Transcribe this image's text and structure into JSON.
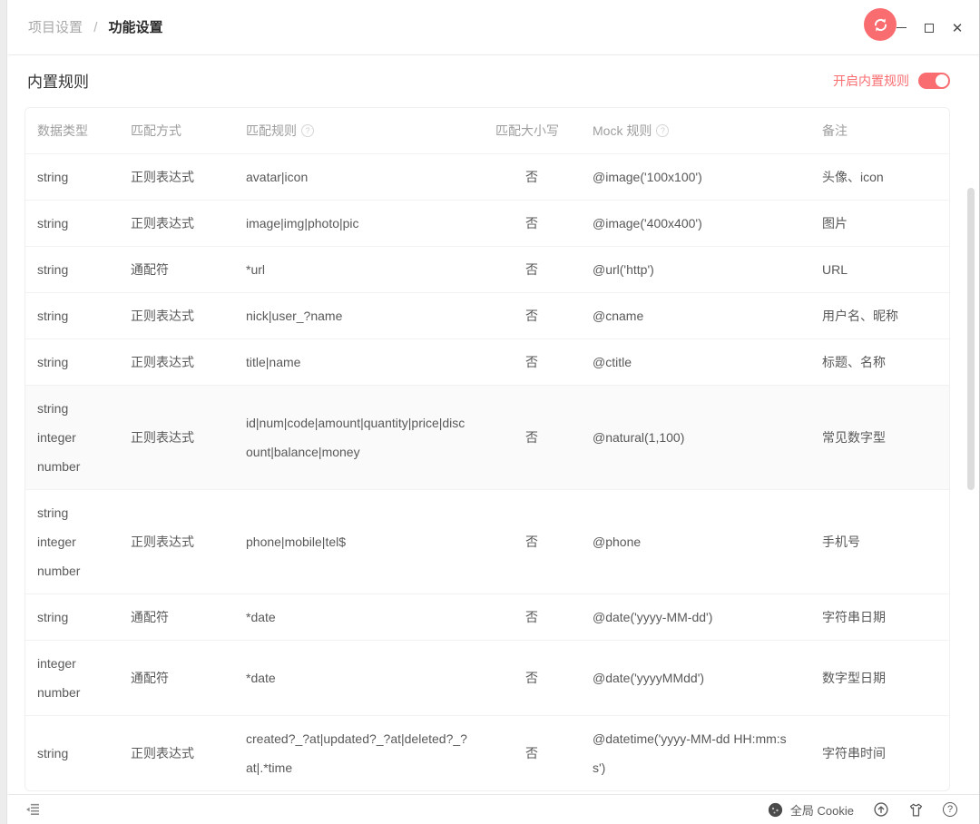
{
  "window": {
    "breadcrumb": {
      "parent": "项目设置",
      "separator": "/",
      "current": "功能设置"
    },
    "controls": {
      "close_glyph": "✕"
    }
  },
  "section": {
    "title": "内置规则",
    "toggle_label": "开启内置规则",
    "toggle_on": true
  },
  "table": {
    "headers": [
      {
        "label": "数据类型",
        "help": false
      },
      {
        "label": "匹配方式",
        "help": false
      },
      {
        "label": "匹配规则",
        "help": true
      },
      {
        "label": "匹配大小写",
        "help": false
      },
      {
        "label": "Mock 规则",
        "help": true
      },
      {
        "label": "备注",
        "help": false
      }
    ],
    "help_glyph": "?",
    "rows": [
      {
        "types": [
          "string"
        ],
        "method": "正则表达式",
        "pattern": "avatar|icon",
        "case_sensitive": "否",
        "mock_rule": "@image('100x100')",
        "note": "头像、icon",
        "highlighted": false
      },
      {
        "types": [
          "string"
        ],
        "method": "正则表达式",
        "pattern": "image|img|photo|pic",
        "case_sensitive": "否",
        "mock_rule": "@image('400x400')",
        "note": "图片",
        "highlighted": false
      },
      {
        "types": [
          "string"
        ],
        "method": "通配符",
        "pattern": "*url",
        "case_sensitive": "否",
        "mock_rule": "@url('http')",
        "note": "URL",
        "highlighted": false
      },
      {
        "types": [
          "string"
        ],
        "method": "正则表达式",
        "pattern": "nick|user_?name",
        "case_sensitive": "否",
        "mock_rule": "@cname",
        "note": "用户名、昵称",
        "highlighted": false
      },
      {
        "types": [
          "string"
        ],
        "method": "正则表达式",
        "pattern": "title|name",
        "case_sensitive": "否",
        "mock_rule": "@ctitle",
        "note": "标题、名称",
        "highlighted": false
      },
      {
        "types": [
          "string",
          "integer",
          "number"
        ],
        "method": "正则表达式",
        "pattern": "id|num|code|amount|quantity|price|discount|balance|money",
        "case_sensitive": "否",
        "mock_rule": "@natural(1,100)",
        "note": "常见数字型",
        "highlighted": true
      },
      {
        "types": [
          "string",
          "integer",
          "number"
        ],
        "method": "正则表达式",
        "pattern": "phone|mobile|tel$",
        "case_sensitive": "否",
        "mock_rule": "@phone",
        "note": "手机号",
        "highlighted": false
      },
      {
        "types": [
          "string"
        ],
        "method": "通配符",
        "pattern": "*date",
        "case_sensitive": "否",
        "mock_rule": "@date('yyyy-MM-dd')",
        "note": "字符串日期",
        "highlighted": false
      },
      {
        "types": [
          "integer",
          "number"
        ],
        "method": "通配符",
        "pattern": "*date",
        "case_sensitive": "否",
        "mock_rule": "@date('yyyyMMdd')",
        "note": "数字型日期",
        "highlighted": false
      },
      {
        "types": [
          "string"
        ],
        "method": "正则表达式",
        "pattern": "created?_?at|updated?_?at|deleted?_?at|.*time",
        "case_sensitive": "否",
        "mock_rule": "@datetime('yyyy-MM-dd HH:mm:ss')",
        "note": "字符串时间",
        "highlighted": false
      }
    ]
  },
  "footer": {
    "cookie_label": "全局 Cookie"
  },
  "colors": {
    "accent": "#f96d70",
    "header_text": "#9e9e9e",
    "cell_text": "#595959",
    "row_divider": "#f2f2f2",
    "highlight_row_bg": "#fafafa"
  }
}
